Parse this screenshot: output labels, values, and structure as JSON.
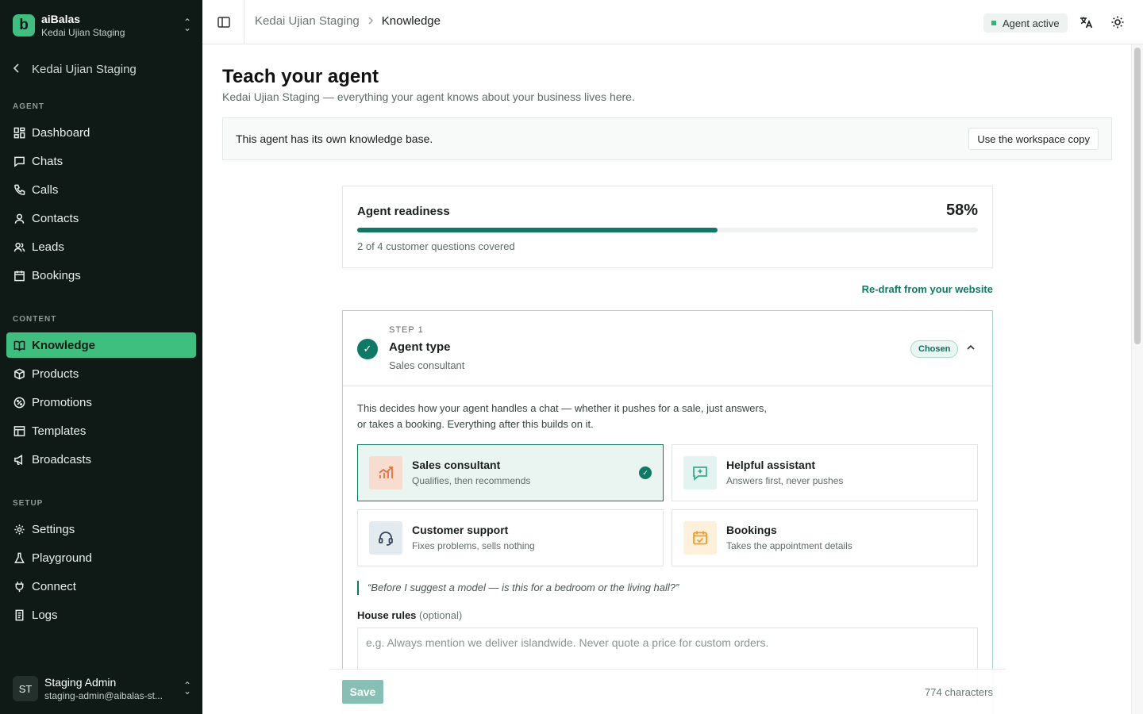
{
  "app": {
    "name": "aiBalas",
    "workspace": "Kedai Ujian Staging",
    "logo_letter": "b"
  },
  "sidebar": {
    "back_label": "Kedai Ujian Staging",
    "sections": {
      "agent": "AGENT",
      "content": "CONTENT",
      "setup": "SETUP"
    },
    "agent_items": [
      {
        "label": "Dashboard",
        "icon": "dashboard-icon"
      },
      {
        "label": "Chats",
        "icon": "chat-icon"
      },
      {
        "label": "Calls",
        "icon": "phone-icon"
      },
      {
        "label": "Contacts",
        "icon": "contact-icon"
      },
      {
        "label": "Leads",
        "icon": "users-icon"
      },
      {
        "label": "Bookings",
        "icon": "calendar-icon"
      }
    ],
    "content_items": [
      {
        "label": "Knowledge",
        "icon": "book-icon",
        "active": true
      },
      {
        "label": "Products",
        "icon": "box-icon"
      },
      {
        "label": "Promotions",
        "icon": "percent-icon"
      },
      {
        "label": "Templates",
        "icon": "template-icon"
      },
      {
        "label": "Broadcasts",
        "icon": "megaphone-icon"
      }
    ],
    "setup_items": [
      {
        "label": "Settings",
        "icon": "gear-icon"
      },
      {
        "label": "Playground",
        "icon": "flask-icon"
      },
      {
        "label": "Connect",
        "icon": "plug-icon"
      },
      {
        "label": "Logs",
        "icon": "logs-icon"
      }
    ],
    "user": {
      "initials": "ST",
      "name": "Staging Admin",
      "email": "staging-admin@aibalas-st..."
    }
  },
  "topbar": {
    "breadcrumb": [
      "Kedai Ujian Staging",
      "Knowledge"
    ],
    "status": "Agent active",
    "colors": {
      "status_dot": "#2fb67a"
    }
  },
  "page": {
    "title": "Teach your agent",
    "subtitle": "Kedai Ujian Staging — everything your agent knows about your business lives here.",
    "kb_banner": {
      "text": "This agent has its own knowledge base.",
      "button": "Use the workspace copy"
    },
    "readiness": {
      "label": "Agent readiness",
      "percent_label": "58%",
      "percent": 58,
      "note": "2 of 4 customer questions covered"
    },
    "redraft_link": "Re-draft from your website",
    "step": {
      "number_label": "STEP 1",
      "title": "Agent type",
      "subtitle": "Sales consultant",
      "badge": "Chosen",
      "description": "This decides how your agent handles a chat — whether it pushes for a sale, just answers, or takes a booking. Everything after this builds on it.",
      "options": [
        {
          "title": "Sales consultant",
          "subtitle": "Qualifies, then recommends",
          "icon": "chart-up-icon",
          "selected": true
        },
        {
          "title": "Helpful assistant",
          "subtitle": "Answers first, never pushes",
          "icon": "sparkle-chat-icon",
          "selected": false
        },
        {
          "title": "Customer support",
          "subtitle": "Fixes problems, sells nothing",
          "icon": "headset-icon",
          "selected": false
        },
        {
          "title": "Bookings",
          "subtitle": "Takes the appointment details",
          "icon": "calendar-check-icon",
          "selected": false
        }
      ],
      "quote": "“Before I suggest a model — is this for a bedroom or the living hall?”",
      "house_rules_label": "House rules",
      "house_rules_optional": "(optional)",
      "house_rules_placeholder": "e.g. Always mention we deliver islandwide. Never quote a price for custom orders."
    },
    "save_button": "Save",
    "char_count": "774 characters"
  },
  "colors": {
    "accent": "#0e7a66",
    "sidebar_bg": "#0f1a17",
    "active_nav": "#3fbf7f"
  }
}
